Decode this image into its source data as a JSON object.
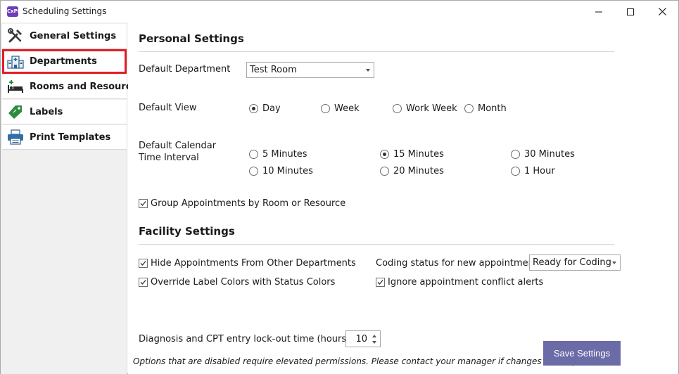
{
  "window": {
    "title": "Scheduling Settings",
    "app_icon_text": "CxPM"
  },
  "sidebar": {
    "items": [
      {
        "label": "General Settings",
        "icon": "tools-icon"
      },
      {
        "label": "Departments",
        "icon": "hospital-icon",
        "selected": true
      },
      {
        "label": "Rooms and Resources",
        "icon": "bed-icon"
      },
      {
        "label": "Labels",
        "icon": "tag-icon"
      },
      {
        "label": "Print Templates",
        "icon": "printer-icon"
      }
    ]
  },
  "personal": {
    "title": "Personal Settings",
    "default_department_label": "Default Department",
    "default_department_value": "Test Room",
    "default_view_label": "Default View",
    "view_options": [
      "Day",
      "Week",
      "Work Week",
      "Month"
    ],
    "view_selected": "Day",
    "interval_label_line1": "Default Calendar",
    "interval_label_line2": "Time Interval",
    "interval_options": [
      "5 Minutes",
      "15 Minutes",
      "30 Minutes",
      "10 Minutes",
      "20 Minutes",
      "1 Hour"
    ],
    "interval_selected": "15 Minutes",
    "group_label": "Group Appointments by Room or Resource",
    "group_checked": true
  },
  "facility": {
    "title": "Facility Settings",
    "hide_label": "Hide Appointments From Other Departments",
    "hide_checked": true,
    "override_label": "Override Label Colors with Status Colors",
    "override_checked": true,
    "coding_label": "Coding status for new appointments",
    "coding_value": "Ready for Coding",
    "ignore_label": "Ignore appointment conflict alerts",
    "ignore_checked": true
  },
  "lockout": {
    "label": "Diagnosis and CPT entry lock-out time (hours)",
    "value": "10"
  },
  "footer": {
    "note": "Options that are disabled require elevated permissions.  Please contact your manager if changes are required.",
    "save_label": "Save Settings"
  },
  "colors": {
    "accent": "#6b6ba8",
    "selection_outline": "#e51b24",
    "sidebar_bg": "#f0f0f0"
  }
}
